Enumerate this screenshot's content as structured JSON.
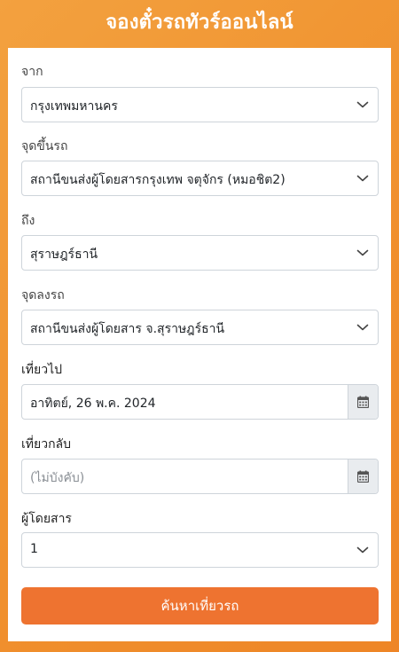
{
  "header": {
    "title": "จองตั๋วรถทัวร์ออนไลน์"
  },
  "form": {
    "origin": {
      "label": "จาก",
      "value": "กรุงเทพมหานคร"
    },
    "boarding_point": {
      "label": "จุดขึ้นรถ",
      "value": "สถานีขนส่งผู้โดยสารกรุงเทพ จตุจักร (หมอชิต2)"
    },
    "destination": {
      "label": "ถึง",
      "value": "สุราษฎร์ธานี"
    },
    "dropoff_point": {
      "label": "จุดลงรถ",
      "value": "สถานีขนส่งผู้โดยสาร จ.สุราษฎร์ธานี"
    },
    "departure_date": {
      "label": "เที่ยวไป",
      "value": "อาทิตย์, 26 พ.ค. 2024"
    },
    "return_date": {
      "label": "เที่ยวกลับ",
      "placeholder": "(ไม่บังคับ)"
    },
    "passengers": {
      "label": "ผู้โดยสาร",
      "value": "1"
    },
    "search_label": "ค้นหาเที่ยวรถ"
  },
  "colors": {
    "background_accent": "#f0922f",
    "button": "#ee7330",
    "card": "#ffffff"
  },
  "icons": {
    "select_arrow": "chevron-down-icon",
    "date_picker": "calendar-icon"
  }
}
